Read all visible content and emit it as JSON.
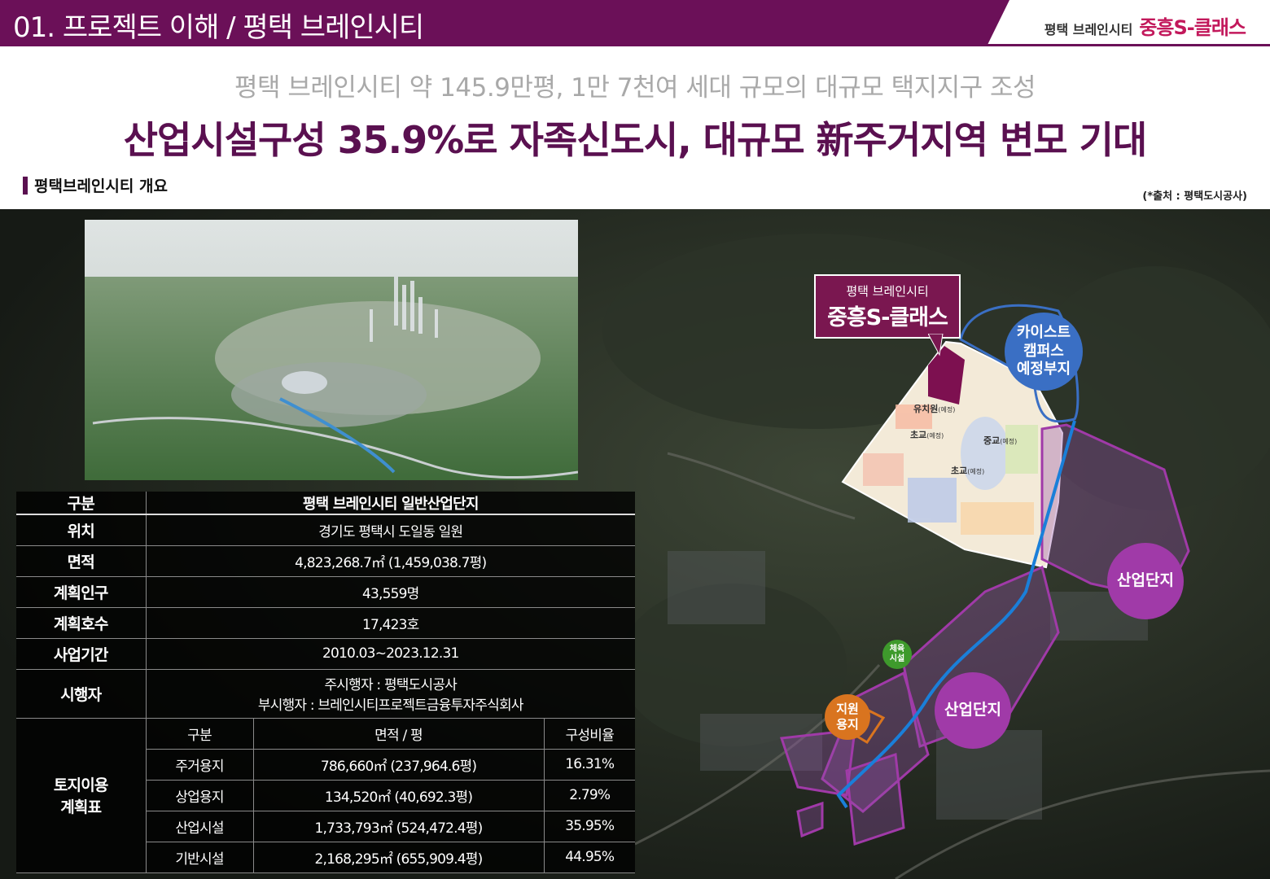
{
  "header": {
    "section_title": "01. 프로젝트 이해 / 평택 브레인시티",
    "brand_small": "평택 브레인시티",
    "brand_big": "중흥S-클래스"
  },
  "headline": {
    "subtitle": "평택 브레인시티 약 145.9만평, 1만 7천여 세대 규모의 대규모 택지지구 조성",
    "title": "산업시설구성 35.9%로 자족신도시, 대규모 新주거지역 변모 기대"
  },
  "section": {
    "label": "평택브레인시티 개요",
    "source": "(*출처 : 평택도시공사)"
  },
  "table": {
    "header": {
      "col1": "구분",
      "col2": "평택 브레인시티 일반산업단지"
    },
    "rows": [
      {
        "label": "위치",
        "value": "경기도 평택시 도일동 일원"
      },
      {
        "label": "면적",
        "value": "4,823,268.7㎡ (1,459,038.7평)"
      },
      {
        "label": "계획인구",
        "value": "43,559명"
      },
      {
        "label": "계획호수",
        "value": "17,423호"
      },
      {
        "label": "사업기간",
        "value": "2010.03~2023.12.31"
      }
    ],
    "operator": {
      "label": "시행자",
      "line1": "주시행자 : 평택도시공사",
      "line2": "부시행자 : 브레인시티프로젝트금융투자주식회사"
    },
    "landuse": {
      "label_line1": "토지이용",
      "label_line2": "계획표",
      "headers": [
        "구분",
        "면적 / 평",
        "구성비율"
      ],
      "rows": [
        {
          "type": "주거용지",
          "area": "786,660㎡ (237,964.6평)",
          "ratio": "16.31%"
        },
        {
          "type": "상업용지",
          "area": "134,520㎡ (40,692.3평)",
          "ratio": "2.79%"
        },
        {
          "type": "산업시설",
          "area": "1,733,793㎡ (524,472.4평)",
          "ratio": "35.95%"
        },
        {
          "type": "기반시설",
          "area": "2,168,295㎡ (655,909.4평)",
          "ratio": "44.95%"
        }
      ]
    }
  },
  "map": {
    "callout_line1": "평택 브레인시티",
    "callout_line2": "중흥S-클래스",
    "kaist_line1": "카이스트",
    "kaist_line2": "캠퍼스",
    "kaist_line3": "예정부지",
    "industrial_1": "산업단지",
    "industrial_2": "산업단지",
    "support_line1": "지원",
    "support_line2": "용지",
    "sports_line1": "체육",
    "sports_line2": "시설",
    "kinder": "유치원",
    "elem1": "초교",
    "middle": "중교",
    "elem2": "초교",
    "planned": "(예정)"
  }
}
